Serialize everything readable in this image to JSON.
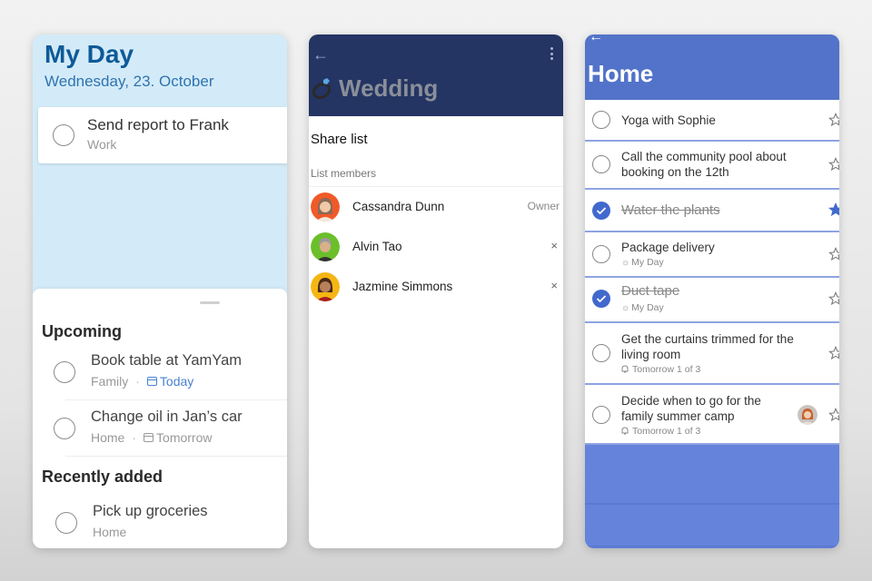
{
  "my_day": {
    "title": "My Day",
    "date": "Wednesday, 23. October",
    "task": {
      "title": "Send report to Frank",
      "list": "Work"
    },
    "sections": [
      {
        "heading": "Upcoming",
        "tasks": [
          {
            "title": "Book table at YamYam",
            "list": "Family",
            "due": "Today",
            "due_highlight": true
          },
          {
            "title": "Change oil in Jan’s car",
            "list": "Home",
            "due": "Tomorrow",
            "due_highlight": false
          }
        ]
      },
      {
        "heading": "Recently added",
        "tasks": [
          {
            "title": "Pick up groceries",
            "list": "Home"
          }
        ]
      }
    ],
    "separator": "·",
    "colors": {
      "title": "#0e5a98",
      "background": "#d3ebf8",
      "due_today": "#4a82cf"
    }
  },
  "wedding": {
    "back_icon": "←",
    "title": "Wedding",
    "title_emoji": "ring-icon",
    "share_heading": "Share list",
    "members_label": "List members",
    "members": [
      {
        "name": "Cassandra Dunn",
        "role": "Owner",
        "avatar_color": "#f05a28"
      },
      {
        "name": "Alvin Tao",
        "remove": "×",
        "avatar_color": "#6bbf2a"
      },
      {
        "name": "Jazmine Simmons",
        "remove": "×",
        "avatar_color": "#f5b614"
      }
    ],
    "colors": {
      "header": "#243463"
    }
  },
  "home": {
    "back_icon": "←",
    "title": "Home",
    "tasks": [
      {
        "title": "Yoga with Sophie",
        "done": false,
        "starred": false
      },
      {
        "title": "Call the community pool about booking on the 12th",
        "done": false,
        "starred": false
      },
      {
        "title": "Water the plants",
        "done": true,
        "starred": true
      },
      {
        "title": "Package delivery",
        "done": false,
        "starred": false,
        "meta": "My Day",
        "meta_icon": "sun-icon"
      },
      {
        "title": "Duct tape",
        "done": true,
        "starred": false,
        "meta": "My Day",
        "meta_icon": "sun-icon"
      },
      {
        "title": "Get the curtains trimmed for the living room",
        "done": false,
        "starred": false,
        "meta": "Tomorrow 1 of 3",
        "meta_icon": "bell-icon"
      },
      {
        "title": "Decide when to go for the family summer camp",
        "done": false,
        "starred": false,
        "meta": "Tomorrow 1 of 3",
        "meta_icon": "bell-icon",
        "assigned": true
      }
    ],
    "colors": {
      "header": "#5273c9",
      "accent": "#4169cd"
    }
  }
}
